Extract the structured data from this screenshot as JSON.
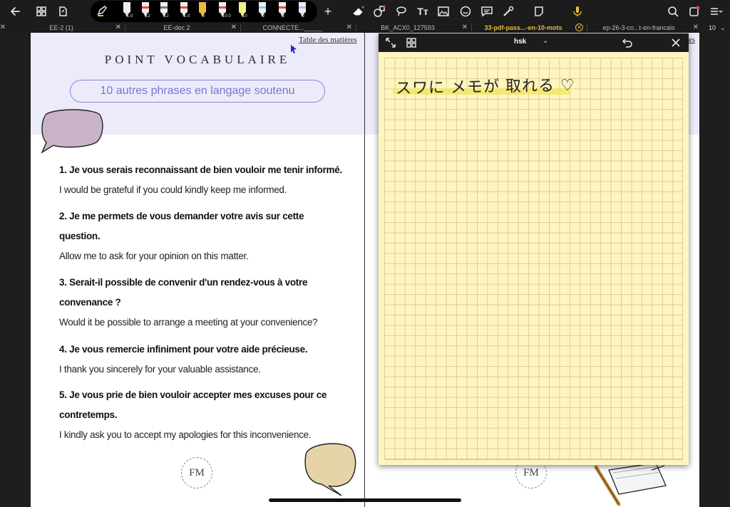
{
  "toolbar": {
    "pen_sizes": [
      "1.0",
      "12",
      "12",
      "1.0",
      "6",
      "10.0",
      "10",
      "2",
      "2",
      "2"
    ],
    "pen_colors": [
      "#ffffff",
      "#ffffff",
      "#ffffff",
      "#ffffff",
      "#f0b93a",
      "#ffffff",
      "#f4ee8a",
      "#7fd3f0",
      "#e84a4a",
      "#c3b7f5"
    ],
    "accent_color": "#f0b93a"
  },
  "tabs": [
    {
      "label": "EE-2 (1)"
    },
    {
      "label": "EE-dec 2"
    },
    {
      "label": "CONNECTE..._____"
    },
    {
      "label": "BK_ACX0_127593"
    },
    {
      "label": "33-pdf-pass...-en-10-mots"
    },
    {
      "label": "ep-26-3-co...t-en-francais"
    }
  ],
  "tab_count": "10",
  "left_page": {
    "toc": "Table des matières",
    "title": "POINT VOCABULAIRE",
    "subtitle": "10 autres phrases en langage soutenu",
    "items": [
      {
        "q1": "1. Je vous serais reconnaissant de bien vouloir me tenir informé.",
        "q2": "",
        "a": "I would be grateful if you could kindly keep me informed."
      },
      {
        "q1": "2. Je me permets de vous demander votre avis sur cette",
        "q2": "question.",
        "a": "Allow me to ask for your opinion on this matter."
      },
      {
        "q1": "3. Serait-il possible de convenir d'un rendez-vous à votre",
        "q2": "convenance ?",
        "a": "Would it be possible to arrange a meeting at your convenience?"
      },
      {
        "q1": "4. Je vous remercie infiniment pour votre aide précieuse.",
        "q2": "",
        "a": "I thank you sincerely for your valuable assistance."
      },
      {
        "q1": "5. Je vous prie de bien vouloir accepter mes excuses pour ce",
        "q2": "contretemps.",
        "a": "I kindly ask you to accept my apologies for this inconvenience."
      }
    ],
    "logo": "FM"
  },
  "right_page": {
    "toc": "es",
    "logo": "FM"
  },
  "note": {
    "title": "hsk",
    "handwriting": "スワに メモが 取れる ♡"
  }
}
